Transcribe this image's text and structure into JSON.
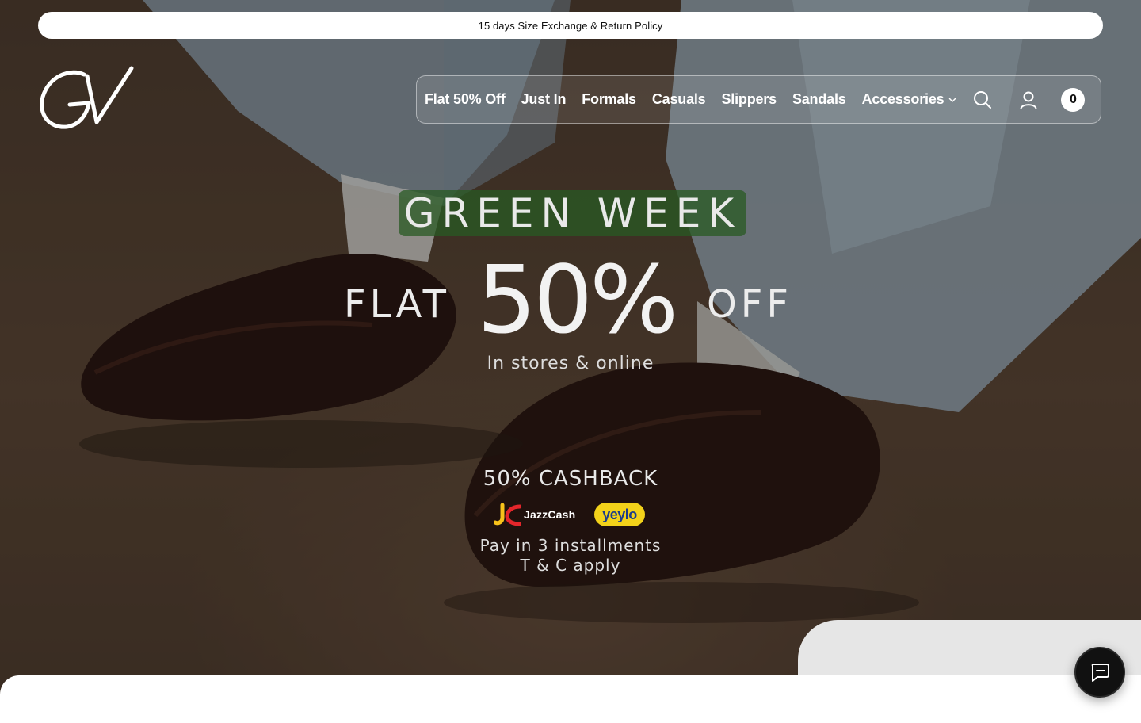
{
  "announcement": {
    "text": "15 days Size Exchange & Return Policy"
  },
  "brand": {
    "logo_icon": "gv-logo-icon"
  },
  "nav": {
    "items": [
      {
        "label": "Flat 50% Off"
      },
      {
        "label": "Just In"
      },
      {
        "label": "Formals"
      },
      {
        "label": "Casuals"
      },
      {
        "label": "Slippers"
      },
      {
        "label": "Sandals"
      },
      {
        "label": "Accessories"
      }
    ],
    "accessories_icon": "chevron-down-icon",
    "search_icon": "search-icon",
    "account_icon": "user-icon",
    "cart_count": "0"
  },
  "hero": {
    "badge": "GREEN WEEK",
    "flat": "FLAT",
    "percent": "50%",
    "off": "OFF",
    "subtitle": "In stores & online",
    "cashback": "50% CASHBACK",
    "partner_1": "JazzCash",
    "partner_2": "yeylo",
    "installments_line1": "Pay in 3 installments",
    "installments_line2": "T & C apply"
  },
  "chat": {
    "icon": "chat-icon"
  },
  "colors": {
    "badge_bg": "#2f6a2a",
    "yeylo_bg": "#f2d21a",
    "jazzcash_red": "#e3262b",
    "jazzcash_yellow": "#f7c21a"
  }
}
